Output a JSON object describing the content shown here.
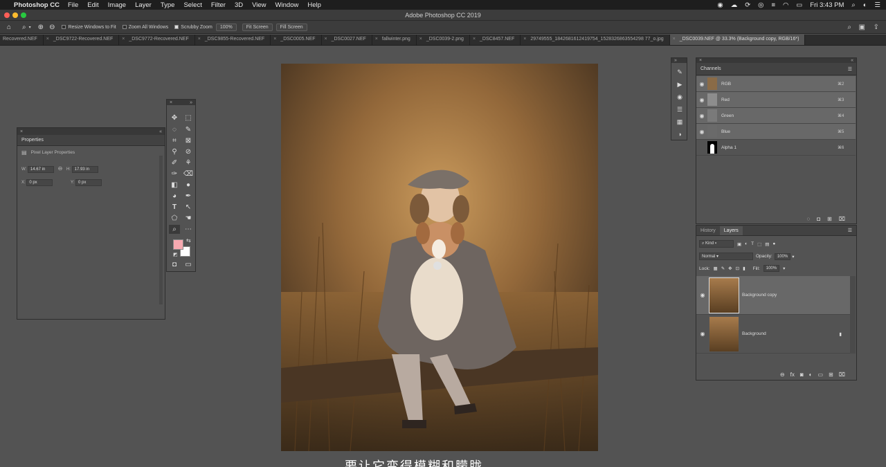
{
  "menubar": {
    "app": "Photoshop CC",
    "items": [
      "File",
      "Edit",
      "Image",
      "Layer",
      "Type",
      "Select",
      "Filter",
      "3D",
      "View",
      "Window",
      "Help"
    ],
    "clock": "Fri 3:43 PM"
  },
  "window": {
    "title": "Adobe Photoshop CC 2019"
  },
  "options": {
    "resize_windows": "Resize Windows to Fit",
    "zoom_all": "Zoom All Windows",
    "scrubby": "Scrubby Zoom",
    "zoom_value": "100%",
    "fit_screen": "Fit Screen",
    "fill_screen": "Fill Screen"
  },
  "tabs": [
    {
      "label": "Recovered.NEF"
    },
    {
      "label": "_DSC9722-Recovered.NEF"
    },
    {
      "label": "_DSC9772-Recovered.NEF"
    },
    {
      "label": "_DSC9855-Recovered.NEF"
    },
    {
      "label": "_DSC0005.NEF"
    },
    {
      "label": "_DSC0027.NEF"
    },
    {
      "label": "fallwinter.png"
    },
    {
      "label": "_DSC0039-2.png"
    },
    {
      "label": "_DSC8457.NEF"
    },
    {
      "label": "29749555_1842681612419754_1528326863554298 77_o.jpg"
    },
    {
      "label": "_DSC0039.NEF @ 33.3% (Background copy, RGB/16*)"
    }
  ],
  "properties": {
    "title": "Properties",
    "subtitle": "Pixel Layer Properties",
    "w_label": "W:",
    "w_value": "14.67 in",
    "h_label": "H:",
    "h_value": "17.93 in",
    "x_label": "X:",
    "x_value": "0 px",
    "y_label": "Y:",
    "y_value": "0 px"
  },
  "colors": {
    "foreground": "#f6a9b0",
    "background": "#ffffff"
  },
  "channels": {
    "title": "Channels",
    "rows": [
      {
        "name": "RGB",
        "key": "⌘2"
      },
      {
        "name": "Red",
        "key": "⌘3"
      },
      {
        "name": "Green",
        "key": "⌘4"
      },
      {
        "name": "Blue",
        "key": "⌘5"
      },
      {
        "name": "Alpha 1",
        "key": "⌘6"
      }
    ]
  },
  "layers": {
    "tab_history": "History",
    "tab_layers": "Layers",
    "kind": "Kind",
    "blend": "Normal",
    "opacity_label": "Opacity:",
    "opacity_value": "100%",
    "lock_label": "Lock:",
    "fill_label": "Fill:",
    "fill_value": "100%",
    "rows": [
      {
        "name": "Background copy"
      },
      {
        "name": "Background"
      }
    ]
  },
  "subtitle": "要让它变得模糊和朦胧"
}
